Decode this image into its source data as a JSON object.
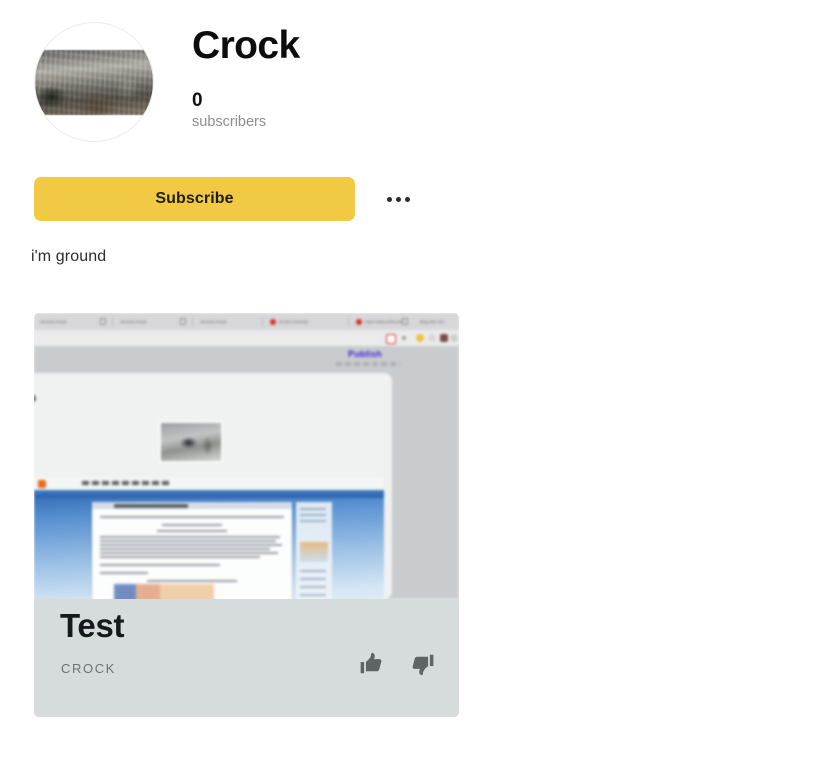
{
  "channel": {
    "name": "Crock",
    "subscriber_count": "0",
    "subscriber_label": "subscribers",
    "description": "i'm ground",
    "avatar_alt": "aerial-cityscape-photo"
  },
  "actions": {
    "subscribe_label": "Subscribe",
    "more_label": "More options",
    "subscribe_color": "#f2c945"
  },
  "video_card": {
    "title": "Test",
    "uploader": "CROCK",
    "like_label": "Like",
    "dislike_label": "Dislike",
    "card_color": "#d6dcdc",
    "thumbnail": {
      "alt": "blurred-browser-screenshot",
      "browser_tabs": [
        "Security threat",
        "Security threat",
        "Security threat",
        "Hit Bot Gateway",
        "https://www.shift.plus"
      ],
      "tab_extra": "Blog with info",
      "page_action_label": "Publish",
      "page_heading": "ls",
      "site_header_text": "INSTAGRAM GANESH"
    }
  }
}
